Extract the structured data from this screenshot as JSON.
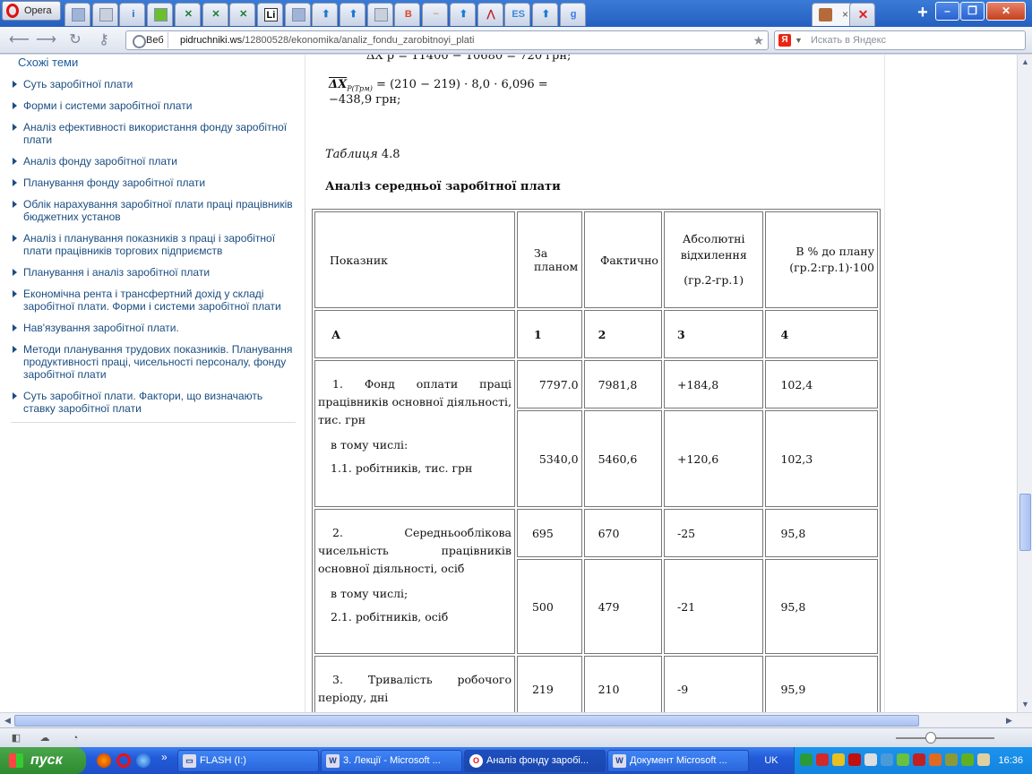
{
  "browser": {
    "opera_label": "Opera",
    "active_tab_close": "×",
    "new_tab": "+",
    "window_buttons": {
      "minimize": "–",
      "maximize": "❐",
      "close": "✕"
    },
    "tab_icons": [
      {
        "name": "page",
        "color": "#9fb4d8",
        "glyph": ""
      },
      {
        "name": "doc",
        "color": "#c8d0dc",
        "glyph": ""
      },
      {
        "name": "info",
        "color": "#1664c9",
        "glyph": "i"
      },
      {
        "name": "apple",
        "color": "#6bbf2e",
        "glyph": ""
      },
      {
        "name": "excel",
        "color": "#1d7a33",
        "glyph": "✕"
      },
      {
        "name": "excel",
        "color": "#1d7a33",
        "glyph": "✕"
      },
      {
        "name": "excel",
        "color": "#1d7a33",
        "glyph": "✕"
      },
      {
        "name": "li",
        "color": "#ffffff",
        "glyph": "Li"
      },
      {
        "name": "page",
        "color": "#9fb4d8",
        "glyph": ""
      },
      {
        "name": "arrow-up",
        "color": "#1f7ad0",
        "glyph": "⬆"
      },
      {
        "name": "arrow-up",
        "color": "#1f7ad0",
        "glyph": "⬆"
      },
      {
        "name": "doc",
        "color": "#c8d0dc",
        "glyph": ""
      },
      {
        "name": "bookpro",
        "color": "#d64a2a",
        "glyph": "B"
      },
      {
        "name": "chart",
        "color": "#d0a070",
        "glyph": "~"
      },
      {
        "name": "arrow-up",
        "color": "#1f7ad0",
        "glyph": "⬆"
      },
      {
        "name": "red-chart",
        "color": "#c0202a",
        "glyph": "⋀"
      },
      {
        "name": "es",
        "color": "#3a8ad8",
        "glyph": "ES"
      },
      {
        "name": "arrow-up",
        "color": "#1f7ad0",
        "glyph": "⬆"
      },
      {
        "name": "google",
        "color": "#3b78e7",
        "glyph": "g"
      }
    ],
    "after_active_icon": {
      "name": "red-x",
      "color": "#e02020",
      "glyph": "✕"
    },
    "address": {
      "web_label": "Веб",
      "url_domain": "pidruchniki.ws",
      "url_path": "/12800528/ekonomika/analiz_fondu_zarobitnoyi_plati",
      "star": "★"
    },
    "search": {
      "engine": "Я",
      "placeholder": "Искать в Яндекс"
    }
  },
  "sidebar": {
    "title": "Схожі теми",
    "items": [
      "Суть заробітної плати",
      "Форми і системи заробітної плати",
      "Аналіз ефективності використання фонду заробітної плати",
      "Аналіз фонду заробітної плати",
      "Планування фонду заробітної плати",
      "Облік нарахування заробітної плати праці працівників бюджетних установ",
      "Аналіз і планування показників з праці і заробітної плати працівників торгових підприємств",
      "Планування і аналіз заробітної плати",
      "Економічна рента і трансфертний дохід у складі заробітної плати. Форми і системи заробітної плати",
      "Нав'язування заробітної плати.",
      "Методи планування трудових показників. Планування продуктивності праці, чисельності персоналу, фонду заробітної плати",
      "Суть заробітної плати. Фактори, що визначають ставку заробітної плати"
    ]
  },
  "content": {
    "formula_1": "ΔX р = 11400 − 10680 = 720 грн;",
    "formula_2_lhs": "ΔX",
    "formula_2_sub": "P(Tрм)",
    "formula_2_rhs": " = (210 − 219) · 8,0 · 6,096 = −438,9 грн;",
    "caption_word": "Таблиця",
    "caption_num": " 4.8",
    "table_title": "Аналіз середньої заробітної плати",
    "table": {
      "headers": [
        "Показник",
        "За планом",
        "Фактично",
        "Абсолютні відхилення",
        "(гр.2-гр.1)",
        "В % до плану (гр.2:гр.1)·100"
      ],
      "index_row": [
        "А",
        "1",
        "2",
        "3",
        "4"
      ],
      "groups": [
        {
          "label_main": "1. Фонд оплати праці працівників основної діяльності, тис. грн",
          "label_sub1": "в тому числі:",
          "label_sub2": "1.1. робітників, тис. грн",
          "row1": [
            "7797.0",
            "7981,8",
            "+184,8",
            "102,4"
          ],
          "row2": [
            "5340,0",
            "5460,6",
            "+120,6",
            "102,3"
          ]
        },
        {
          "label_main": "2. Середньооблікова чисельність працівників основної діяльності, осіб",
          "label_sub1": "в тому числі;",
          "label_sub2": "2.1. робітників, осіб",
          "row1": [
            "695",
            "670",
            "-25",
            "95,8"
          ],
          "row2": [
            "500",
            "479",
            "-21",
            "95,8"
          ]
        },
        {
          "label_main": "3. Тривалість робочого періоду, дні",
          "row1": [
            "219",
            "210",
            "-9",
            "95,9"
          ]
        }
      ]
    }
  },
  "taskbar": {
    "start_label": "пуск",
    "more": "»",
    "tasks": [
      {
        "label": "FLASH (I:)",
        "icon": "drive"
      },
      {
        "label": "3. Лекції - Microsoft ...",
        "icon": "W"
      },
      {
        "label": "Аналіз фонду заробі...",
        "icon": "O"
      },
      {
        "label": "Документ Microsoft ...",
        "icon": "W"
      }
    ],
    "language": "UK",
    "clock": "16:36"
  }
}
